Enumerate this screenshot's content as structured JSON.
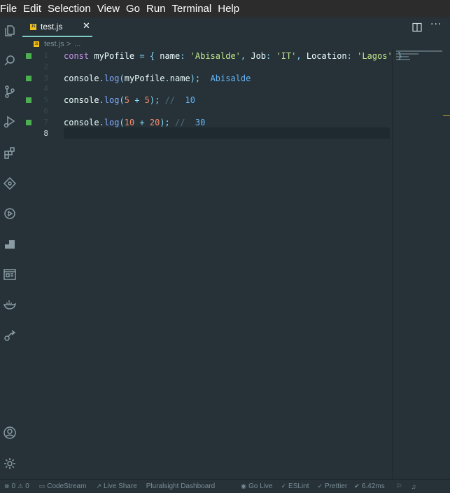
{
  "menubar": {
    "items": [
      "File",
      "Edit",
      "Selection",
      "View",
      "Go",
      "Run",
      "Terminal",
      "Help"
    ]
  },
  "activity_icons": [
    "files-icon",
    "search-icon",
    "source-control-icon",
    "run-debug-icon",
    "extensions-icon",
    "gitlens-icon",
    "live-share-icon",
    "pluralsight-icon",
    "preview-icon",
    "docker-icon",
    "remote-icon",
    "account-icon",
    "settings-gear-icon"
  ],
  "tab": {
    "badge": "JS",
    "label": "test.js",
    "close": "✕",
    "more": "···"
  },
  "breadcrumb": {
    "badge": "JS",
    "file": "test.js",
    "separator": ">",
    "more": "..."
  },
  "editor": {
    "line_numbers": [
      "1",
      "2",
      "3",
      "4",
      "5",
      "6",
      "7",
      "8"
    ],
    "lines": [
      {
        "tokens": [
          {
            "t": "const",
            "c": "kw"
          },
          {
            "t": " myPofile ",
            "c": "var"
          },
          {
            "t": "=",
            "c": "punc"
          },
          {
            "t": " { ",
            "c": "punc"
          },
          {
            "t": "name",
            "c": "prop"
          },
          {
            "t": ": ",
            "c": "punc"
          },
          {
            "t": "'Abisalde'",
            "c": "str"
          },
          {
            "t": ", ",
            "c": "punc"
          },
          {
            "t": "Job",
            "c": "prop"
          },
          {
            "t": ": ",
            "c": "punc"
          },
          {
            "t": "'IT'",
            "c": "str"
          },
          {
            "t": ", ",
            "c": "punc"
          },
          {
            "t": "Location",
            "c": "prop"
          },
          {
            "t": ": ",
            "c": "punc"
          },
          {
            "t": "'Lagos'",
            "c": "str"
          },
          {
            "t": " }",
            "c": "punc"
          }
        ]
      },
      {
        "tokens": []
      },
      {
        "tokens": [
          {
            "t": "console",
            "c": "var"
          },
          {
            "t": ".",
            "c": "punc"
          },
          {
            "t": "log",
            "c": "fn"
          },
          {
            "t": "(",
            "c": "punc"
          },
          {
            "t": "myPofile",
            "c": "var"
          },
          {
            "t": ".",
            "c": "punc"
          },
          {
            "t": "name",
            "c": "prop"
          },
          {
            "t": ");",
            "c": "punc"
          },
          {
            "t": "  Abisalde",
            "c": "res"
          }
        ]
      },
      {
        "tokens": []
      },
      {
        "tokens": [
          {
            "t": "console",
            "c": "var"
          },
          {
            "t": ".",
            "c": "punc"
          },
          {
            "t": "log",
            "c": "fn"
          },
          {
            "t": "(",
            "c": "punc"
          },
          {
            "t": "5",
            "c": "num"
          },
          {
            "t": " + ",
            "c": "punc"
          },
          {
            "t": "5",
            "c": "num"
          },
          {
            "t": ");",
            "c": "punc"
          },
          {
            "t": " //",
            "c": "cm"
          },
          {
            "t": "  10",
            "c": "res"
          }
        ]
      },
      {
        "tokens": []
      },
      {
        "tokens": [
          {
            "t": "console",
            "c": "var"
          },
          {
            "t": ".",
            "c": "punc"
          },
          {
            "t": "log",
            "c": "fn"
          },
          {
            "t": "(",
            "c": "punc"
          },
          {
            "t": "10",
            "c": "num"
          },
          {
            "t": " + ",
            "c": "punc"
          },
          {
            "t": "20",
            "c": "num"
          },
          {
            "t": ");",
            "c": "punc"
          },
          {
            "t": " //",
            "c": "cm"
          },
          {
            "t": "  30",
            "c": "res"
          }
        ]
      },
      {
        "tokens": []
      }
    ]
  },
  "statusbar": {
    "errors": "0",
    "warnings": "0",
    "codestream": "CodeStream",
    "liveshare": "Live Share",
    "pluralsight": "Pluralsight Dashboard",
    "golive": "Go Live",
    "eslint": "ESLint",
    "prettier": "Prettier",
    "timing": "6.42ms"
  },
  "colors": {
    "background": "#263238",
    "menubar": "#2c2c2c",
    "tab_accent": "#80cbc4",
    "gutter_mark": "#4caf50",
    "js_badge": "#f3c01a"
  }
}
